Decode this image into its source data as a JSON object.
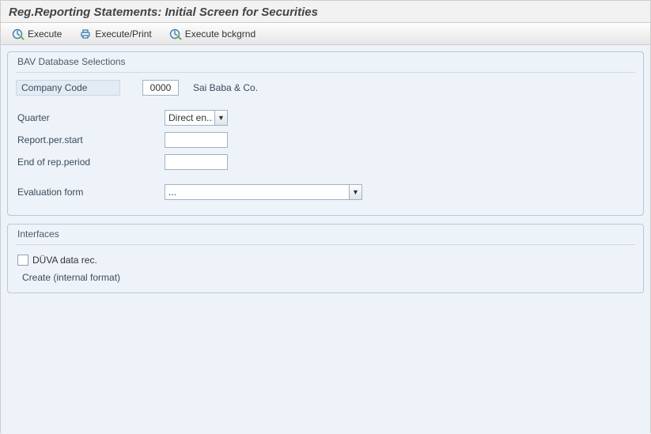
{
  "title": "Reg.Reporting Statements: Initial Screen for Securities",
  "toolbar": {
    "execute": "Execute",
    "execute_print": "Execute/Print",
    "execute_bckgrnd": "Execute bckgrnd"
  },
  "group1": {
    "title": "BAV Database Selections",
    "company_code_label": "Company Code",
    "company_code_value": "0000",
    "company_code_text": "Sai Baba & Co.",
    "quarter_label": "Quarter",
    "quarter_value": "Direct en...",
    "report_start_label": "Report.per.start",
    "report_start_value": "",
    "report_end_label": "End of rep.period",
    "report_end_value": "",
    "eval_label": "Evaluation form",
    "eval_value": "..."
  },
  "group2": {
    "title": "Interfaces",
    "duva_label": "DÜVA data rec.",
    "create_label": "Create (internal format)"
  }
}
